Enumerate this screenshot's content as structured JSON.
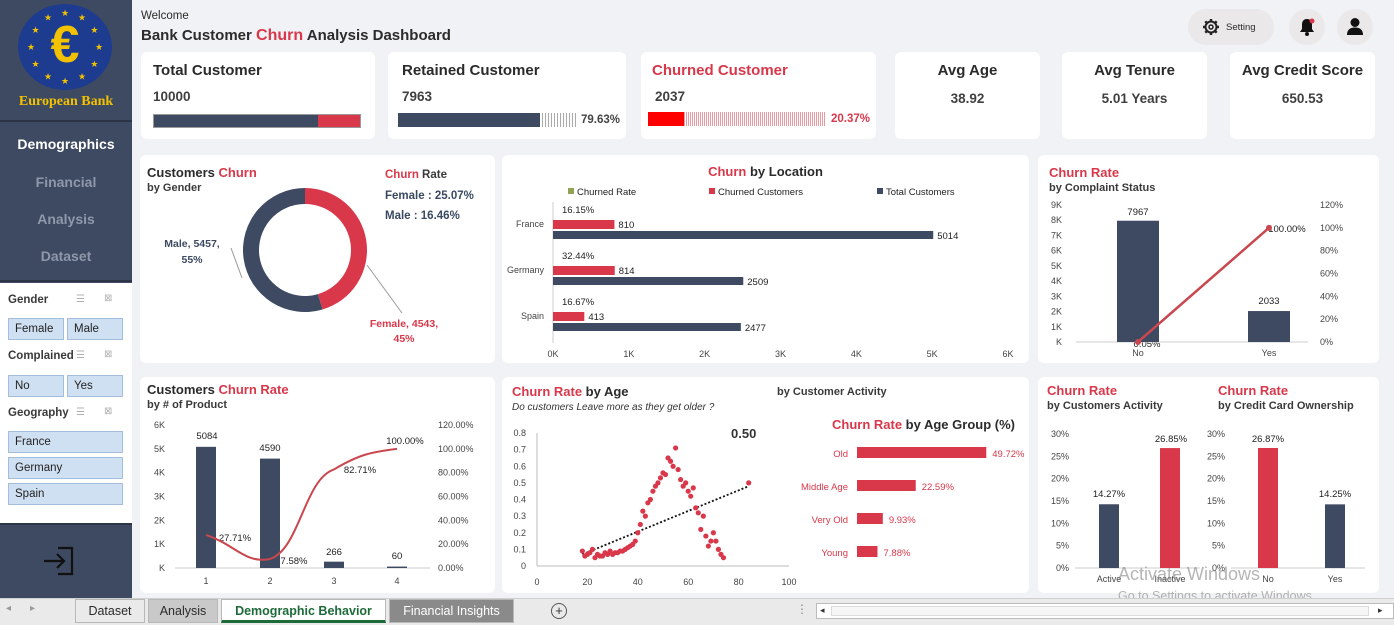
{
  "brand": {
    "name": "European Bank",
    "symbol": "€"
  },
  "nav": [
    {
      "label": "Demographics",
      "active": true
    },
    {
      "label": "Financial",
      "active": false
    },
    {
      "label": "Analysis",
      "active": false
    },
    {
      "label": "Dataset",
      "active": false
    }
  ],
  "slicers": {
    "gender": {
      "title": "Gender",
      "items": [
        "Female",
        "Male"
      ]
    },
    "complained": {
      "title": "Complained",
      "items": [
        "No",
        "Yes"
      ]
    },
    "geography": {
      "title": "Geography",
      "items": [
        "France",
        "Germany",
        "Spain"
      ]
    }
  },
  "header": {
    "welcome": "Welcome",
    "title_pre": "Bank Customer ",
    "title_red": "Churn",
    "title_post": " Analysis Dashboard",
    "setting": "Setting"
  },
  "kpis": {
    "total": {
      "title": "Total Customer",
      "value": "10000",
      "retained_fraction": 0.7963
    },
    "retained": {
      "title": "Retained Customer",
      "value": "7963",
      "pct": "79.63%",
      "fraction": 0.7963
    },
    "churned": {
      "title": "Churned Customer",
      "value": "2037",
      "pct": "20.37%",
      "fraction": 0.2037
    },
    "age": {
      "title": "Avg Age",
      "value": "38.92"
    },
    "tenure": {
      "title": "Avg Tenure",
      "value": "5.01 Years"
    },
    "credit": {
      "title": "Avg Credit Score",
      "value": "650.53"
    }
  },
  "gender": {
    "title_pre": "Customers ",
    "title_red": "Churn",
    "subtitle": "by Gender",
    "rate_red": "Churn",
    "rate_post": " Rate",
    "female_rate": "Female : 25.07%",
    "male_rate": "Male : 16.46%",
    "male_label_1": "Male, 5457,",
    "male_label_2": "55%",
    "female_label_1": "Female, 4543,",
    "female_label_2": "45%",
    "colors": {
      "male": "#3e4a61",
      "female": "#d8384a"
    }
  },
  "location": {
    "title_red": "Churn",
    "title_post": " by Location",
    "legend": [
      "Churned Rate",
      "Churned Customers",
      "Total Customers"
    ],
    "x_ticks": [
      "0K",
      "1K",
      "2K",
      "3K",
      "4K",
      "5K",
      "6K"
    ]
  },
  "complaint": {
    "title": "Churn Rate",
    "subtitle": "by Complaint Status",
    "y_ticks": [
      "9K",
      "8K",
      "7K",
      "6K",
      "5K",
      "4K",
      "3K",
      "2K",
      "1K",
      "K"
    ],
    "y2_ticks": [
      "120%",
      "100%",
      "80%",
      "60%",
      "40%",
      "20%",
      "0%"
    ],
    "labels": {
      "no_bar": "7967",
      "yes_bar": "2033",
      "no_rate": "0.05%",
      "yes_rate": "100.00%"
    }
  },
  "product": {
    "title_pre": "Customers ",
    "title_red": "Churn Rate",
    "subtitle": "by # of Product",
    "y_ticks": [
      "6K",
      "5K",
      "4K",
      "3K",
      "2K",
      "1K",
      "K"
    ],
    "y2_ticks": [
      "120.00%",
      "100.00%",
      "80.00%",
      "60.00%",
      "40.00%",
      "20.00%",
      "0.00%"
    ],
    "labels": {
      "c1": "5084",
      "c2": "4590",
      "c3": "266",
      "c4": "60",
      "r1": "27.71%",
      "r2": "7.58%",
      "r3": "82.71%",
      "r4": "100.00%"
    }
  },
  "age": {
    "title_red": "Churn Rate",
    "title_post": " by Age",
    "question": "Do customers Leave more as they get older ?",
    "activity_header": "by Customer Activity",
    "r2": "0.50",
    "y_ticks": [
      "0.8",
      "0.7",
      "0.6",
      "0.5",
      "0.4",
      "0.3",
      "0.2",
      "0.1",
      "0"
    ],
    "x_ticks": [
      "0",
      "20",
      "40",
      "60",
      "80",
      "100"
    ],
    "group_title_red": "Churn Rate",
    "group_title_post": " by Age Group (%)"
  },
  "activity": {
    "title": "Churn Rate",
    "subtitle": "by Customers Activity",
    "y_ticks": [
      "30%",
      "25%",
      "20%",
      "15%",
      "10%",
      "5%",
      "0%"
    ],
    "labels": {
      "active": "14.27%",
      "inactive": "26.85%"
    }
  },
  "card": {
    "title": "Churn Rate",
    "subtitle": "by Credit Card Ownership",
    "y_ticks": [
      "30%",
      "25%",
      "20%",
      "15%",
      "10%",
      "5%",
      "0%"
    ],
    "labels": {
      "no": "26.87%",
      "yes": "14.25%"
    }
  },
  "tabs": [
    {
      "label": "Dataset",
      "active": false
    },
    {
      "label": "Analysis",
      "active": false
    },
    {
      "label": "Demographic Behavior",
      "active": true
    },
    {
      "label": "Financial Insights",
      "active": false
    }
  ],
  "watermark": {
    "line1": "Activate Windows",
    "line2": "Go to Settings to activate Windows."
  },
  "chart_data": [
    {
      "type": "pie",
      "title": "Customers Churn by Gender",
      "categories": [
        "Male",
        "Female"
      ],
      "values": [
        5457,
        4543
      ],
      "percent": [
        55,
        45
      ]
    },
    {
      "type": "bar",
      "title": "Churn by Location",
      "categories": [
        "France",
        "Germany",
        "Spain"
      ],
      "series": [
        {
          "name": "Churned Rate",
          "values": [
            16.15,
            32.44,
            16.67
          ]
        },
        {
          "name": "Churned Customers",
          "values": [
            810,
            814,
            413
          ]
        },
        {
          "name": "Total Customers",
          "values": [
            5014,
            2509,
            2477
          ]
        }
      ],
      "xlim": [
        0,
        6000
      ]
    },
    {
      "type": "bar",
      "title": "Churn Rate by Complaint Status",
      "categories": [
        "No",
        "Yes"
      ],
      "series": [
        {
          "name": "Customers",
          "values": [
            7967,
            2033
          ]
        },
        {
          "name": "Churn Rate",
          "values": [
            0.05,
            100.0
          ]
        }
      ],
      "ylim": [
        0,
        9000
      ],
      "y2lim": [
        0,
        120
      ]
    },
    {
      "type": "bar",
      "title": "Customers Churn Rate by # of Product",
      "categories": [
        "1",
        "2",
        "3",
        "4"
      ],
      "series": [
        {
          "name": "Customers",
          "values": [
            5084,
            4590,
            266,
            60
          ]
        },
        {
          "name": "Churn Rate",
          "values": [
            27.71,
            7.58,
            82.71,
            100.0
          ]
        }
      ],
      "ylim": [
        0,
        6000
      ],
      "y2lim": [
        0,
        120
      ]
    },
    {
      "type": "scatter",
      "title": "Churn Rate by Age",
      "xlim": [
        0,
        100
      ],
      "ylim": [
        0,
        0.8
      ],
      "trendline_r2": 0.5,
      "x": [
        18,
        19,
        20,
        21,
        22,
        23,
        24,
        25,
        26,
        27,
        28,
        29,
        30,
        31,
        32,
        33,
        34,
        35,
        36,
        37,
        38,
        39,
        40,
        41,
        42,
        43,
        44,
        45,
        46,
        47,
        48,
        49,
        50,
        51,
        52,
        53,
        54,
        55,
        56,
        57,
        58,
        59,
        60,
        61,
        62,
        63,
        64,
        65,
        66,
        67,
        68,
        69,
        70,
        71,
        72,
        73,
        74,
        84
      ],
      "y": [
        0.09,
        0.06,
        0.07,
        0.08,
        0.1,
        0.05,
        0.07,
        0.06,
        0.06,
        0.08,
        0.07,
        0.09,
        0.07,
        0.08,
        0.08,
        0.09,
        0.09,
        0.1,
        0.11,
        0.12,
        0.13,
        0.15,
        0.2,
        0.25,
        0.33,
        0.3,
        0.38,
        0.4,
        0.45,
        0.48,
        0.5,
        0.53,
        0.56,
        0.55,
        0.65,
        0.63,
        0.6,
        0.71,
        0.58,
        0.52,
        0.48,
        0.5,
        0.45,
        0.42,
        0.47,
        0.35,
        0.32,
        0.22,
        0.3,
        0.18,
        0.12,
        0.15,
        0.2,
        0.15,
        0.1,
        0.07,
        0.05,
        0.5
      ]
    },
    {
      "type": "bar",
      "title": "Churn Rate by Age Group (%)",
      "categories": [
        "Old",
        "Middle Age",
        "Very Old",
        "Young"
      ],
      "values": [
        49.72,
        22.59,
        9.93,
        7.88
      ]
    },
    {
      "type": "bar",
      "title": "Churn Rate by Customers Activity",
      "categories": [
        "Active",
        "Inactive"
      ],
      "values": [
        14.27,
        26.85
      ],
      "ylim": [
        0,
        30
      ]
    },
    {
      "type": "bar",
      "title": "Churn Rate by Credit Card Ownership",
      "categories": [
        "No",
        "Yes"
      ],
      "values": [
        26.87,
        14.25
      ],
      "ylim": [
        0,
        30
      ]
    }
  ]
}
